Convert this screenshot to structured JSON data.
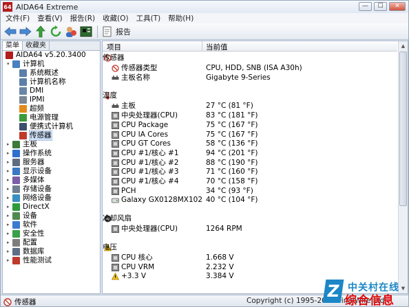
{
  "window": {
    "app_icon": "64",
    "title": "AIDA64 Extreme",
    "controls": {
      "minimize": "—",
      "maximize": "☐",
      "close": "✕"
    }
  },
  "menu": [
    "文件(F)",
    "查看(V)",
    "报告(R)",
    "收藏(O)",
    "工具(T)",
    "帮助(H)"
  ],
  "toolbar": {
    "buttons": [
      "back-icon",
      "forward-icon",
      "up-icon",
      "refresh-icon",
      "user-icon",
      "motherboard-icon"
    ],
    "report_label": "报告"
  },
  "left_panel": {
    "tabs": [
      "菜单",
      "收藏夹"
    ],
    "tree": [
      {
        "label": "AIDA64 v5.20.3400",
        "level": 0,
        "toggle": "",
        "icon": "aida64-icon",
        "color": "#b21c1c"
      },
      {
        "label": "计算机",
        "level": 1,
        "toggle": "▾",
        "icon": "computer-icon",
        "color": "#4a7fc1"
      },
      {
        "label": "系统概述",
        "level": 2,
        "toggle": "",
        "icon": "summary-icon",
        "color": "#5b7fa8"
      },
      {
        "label": "计算机名称",
        "level": 2,
        "toggle": "",
        "icon": "computer-name-icon",
        "color": "#5b7fa8"
      },
      {
        "label": "DMI",
        "level": 2,
        "toggle": "",
        "icon": "dmi-icon",
        "color": "#6a86a6"
      },
      {
        "label": "IPMI",
        "level": 2,
        "toggle": "",
        "icon": "ipmi-icon",
        "color": "#7a8795"
      },
      {
        "label": "超频",
        "level": 2,
        "toggle": "",
        "icon": "overclock-icon",
        "color": "#e28a1b"
      },
      {
        "label": "电源管理",
        "level": 2,
        "toggle": "",
        "icon": "power-icon",
        "color": "#3c9a3c"
      },
      {
        "label": "便携式计算机",
        "level": 2,
        "toggle": "",
        "icon": "laptop-icon",
        "color": "#3d4f6b"
      },
      {
        "label": "传感器",
        "level": 2,
        "toggle": "",
        "icon": "sensor-icon",
        "color": "#c0392b",
        "selected": true
      },
      {
        "label": "主板",
        "level": 1,
        "toggle": "▸",
        "icon": "motherboard-icon",
        "color": "#3c7a3c"
      },
      {
        "label": "操作系统",
        "level": 1,
        "toggle": "▸",
        "icon": "os-icon",
        "color": "#2f6fcf"
      },
      {
        "label": "服务器",
        "level": 1,
        "toggle": "▸",
        "icon": "server-icon",
        "color": "#5e6e82"
      },
      {
        "label": "显示设备",
        "level": 1,
        "toggle": "▸",
        "icon": "display-icon",
        "color": "#3a78c2"
      },
      {
        "label": "多媒体",
        "level": 1,
        "toggle": "▸",
        "icon": "multimedia-icon",
        "color": "#7b5ea7"
      },
      {
        "label": "存储设备",
        "level": 1,
        "toggle": "▸",
        "icon": "storage-icon",
        "color": "#6f7f8f"
      },
      {
        "label": "网络设备",
        "level": 1,
        "toggle": "▸",
        "icon": "network-icon",
        "color": "#3a8fc2"
      },
      {
        "label": "DirectX",
        "level": 1,
        "toggle": "▸",
        "icon": "directx-icon",
        "color": "#2d9b3a"
      },
      {
        "label": "设备",
        "level": 1,
        "toggle": "▸",
        "icon": "devices-icon",
        "color": "#4f8a4f"
      },
      {
        "label": "软件",
        "level": 1,
        "toggle": "▸",
        "icon": "software-icon",
        "color": "#3b7bd0"
      },
      {
        "label": "安全性",
        "level": 1,
        "toggle": "▸",
        "icon": "security-icon",
        "color": "#3aa04a"
      },
      {
        "label": "配置",
        "level": 1,
        "toggle": "▸",
        "icon": "config-icon",
        "color": "#7d7d7d"
      },
      {
        "label": "数据库",
        "level": 1,
        "toggle": "▸",
        "icon": "database-icon",
        "color": "#5d6f86"
      },
      {
        "label": "性能测试",
        "level": 1,
        "toggle": "▸",
        "icon": "benchmark-icon",
        "color": "#c0392b"
      }
    ]
  },
  "right_panel": {
    "columns": [
      "项目",
      "当前值"
    ],
    "rows": [
      {
        "kind": "section",
        "name": "传感器",
        "value": "",
        "icon": "sensor-icon"
      },
      {
        "kind": "item",
        "name": "传感器类型",
        "value": "CPU, HDD, SNB  (ISA A30h)",
        "icon": "sensor-small-icon"
      },
      {
        "kind": "item",
        "name": "主板名称",
        "value": "Gigabyte 9-Series",
        "icon": "motherboard-icon"
      },
      {
        "kind": "gap"
      },
      {
        "kind": "section",
        "name": "温度",
        "value": "",
        "icon": "thermometer-icon"
      },
      {
        "kind": "item",
        "name": "主板",
        "value": "27 °C  (81 °F)",
        "icon": "motherboard-icon"
      },
      {
        "kind": "item",
        "name": "中央处理器(CPU)",
        "value": "83 °C  (181 °F)",
        "icon": "chip-icon"
      },
      {
        "kind": "item",
        "name": "CPU Package",
        "value": "75 °C  (167 °F)",
        "icon": "chip-icon"
      },
      {
        "kind": "item",
        "name": "CPU IA Cores",
        "value": "75 °C  (167 °F)",
        "icon": "chip-icon"
      },
      {
        "kind": "item",
        "name": "CPU GT Cores",
        "value": "58 °C  (136 °F)",
        "icon": "chip-icon"
      },
      {
        "kind": "item",
        "name": "CPU #1/核心 #1",
        "value": "94 °C  (201 °F)",
        "icon": "chip-icon"
      },
      {
        "kind": "item",
        "name": "CPU #1/核心 #2",
        "value": "88 °C  (190 °F)",
        "icon": "chip-icon"
      },
      {
        "kind": "item",
        "name": "CPU #1/核心 #3",
        "value": "71 °C  (160 °F)",
        "icon": "chip-icon"
      },
      {
        "kind": "item",
        "name": "CPU #1/核心 #4",
        "value": "70 °C  (158 °F)",
        "icon": "chip-icon"
      },
      {
        "kind": "item",
        "name": "PCH",
        "value": "34 °C  (93 °F)",
        "icon": "pch-icon"
      },
      {
        "kind": "item",
        "name": "Galaxy GX0128MX102",
        "value": "40 °C  (104 °F)",
        "icon": "hdd-icon"
      },
      {
        "kind": "gap"
      },
      {
        "kind": "section",
        "name": "冷却风扇",
        "value": "",
        "icon": "fan-icon"
      },
      {
        "kind": "item",
        "name": "中央处理器(CPU)",
        "value": "1264 RPM",
        "icon": "chip-icon"
      },
      {
        "kind": "gap"
      },
      {
        "kind": "section",
        "name": "电压",
        "value": "",
        "icon": "warning-icon"
      },
      {
        "kind": "item",
        "name": "CPU 核心",
        "value": "1.668 V",
        "icon": "chip-icon"
      },
      {
        "kind": "item",
        "name": "CPU VRM",
        "value": "2.232 V",
        "icon": "chip-icon"
      },
      {
        "kind": "item",
        "name": "+3.3 V",
        "value": "3.384 V",
        "icon": "warning-icon"
      }
    ]
  },
  "statusbar": {
    "left_label": "传感器",
    "right_label": "Copyright (c) 1995-2015 FinalWire Ltd."
  },
  "watermark": {
    "logo": "Z",
    "line1": "中关村在线",
    "line2": "综合信息"
  }
}
